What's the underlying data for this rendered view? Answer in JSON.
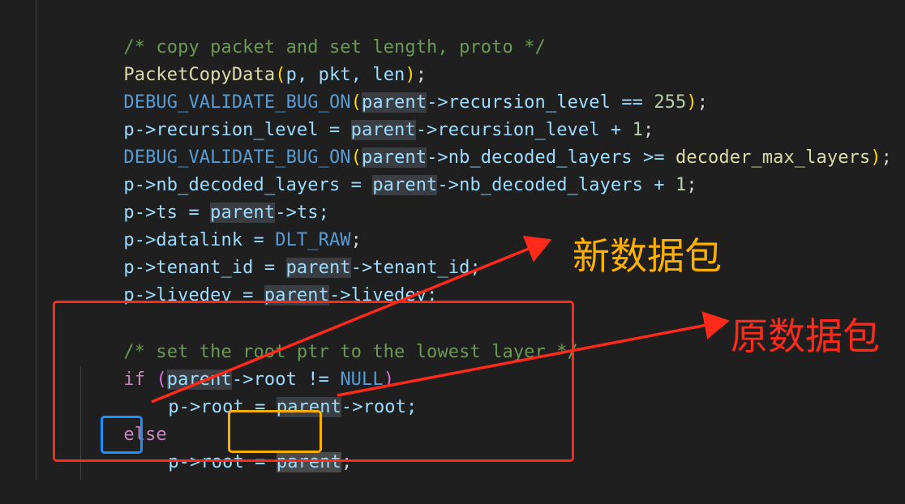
{
  "code": {
    "line1": "/* copy packet and set length, proto */",
    "line2": {
      "fn": "PacketCopyData",
      "open": "(",
      "args": "p, pkt, len",
      "close": ")",
      "end": ";"
    },
    "line3": {
      "macro": "DEBUG_VALIDATE_BUG_ON",
      "open": "(",
      "parent": "parent",
      "rest": "->recursion_level == ",
      "num": "255",
      "close": ")",
      "end": ";"
    },
    "line4": {
      "lhs": "p->recursion_level = ",
      "parent": "parent",
      "rest": "->recursion_level + ",
      "num": "1",
      "end": ";"
    },
    "line5": {
      "macro": "DEBUG_VALIDATE_BUG_ON",
      "open": "(",
      "parent": "parent",
      "rest": "->nb_decoded_layers >= ",
      "fn": "decoder_max_layers",
      "close": ")",
      "end": ";"
    },
    "line6": {
      "lhs": "p->nb_decoded_layers = ",
      "parent": "parent",
      "rest": "->nb_decoded_layers + ",
      "num": "1",
      "end": ";"
    },
    "line7": {
      "lhs": "p->ts = ",
      "parent": "parent",
      "rest": "->ts;"
    },
    "line8": {
      "lhs": "p->datalink = ",
      "const": "DLT_RAW",
      "end": ";"
    },
    "line9": {
      "lhs": "p->tenant_id = ",
      "parent": "parent",
      "rest": "->tenant_id;"
    },
    "line10": {
      "lhs": "p->livedev = ",
      "parent": "parent",
      "rest": "->livedev;"
    },
    "line11": "/* set the root ptr to the lowest layer */",
    "line12": {
      "kw": "if",
      "open": " (",
      "parent": "parent",
      "rest": "->root != ",
      "null": "NULL",
      "close": ")"
    },
    "line13": {
      "lhs": "p->root = ",
      "parent": "parent",
      "rest": "->root;"
    },
    "line14": {
      "kw": "else"
    },
    "line15": {
      "p": "p",
      "mid": "->root = ",
      "parent": "parent",
      "end": ";"
    }
  },
  "annotations": {
    "new_packet_label": "新数据包",
    "orig_packet_label": "原数据包",
    "colors": {
      "new_label": "#ffb000",
      "orig_label": "#ff2a1a",
      "arrow": "#ff2a1a",
      "blue_box": "#1e90ff",
      "yellow_box": "#ffb000"
    }
  }
}
